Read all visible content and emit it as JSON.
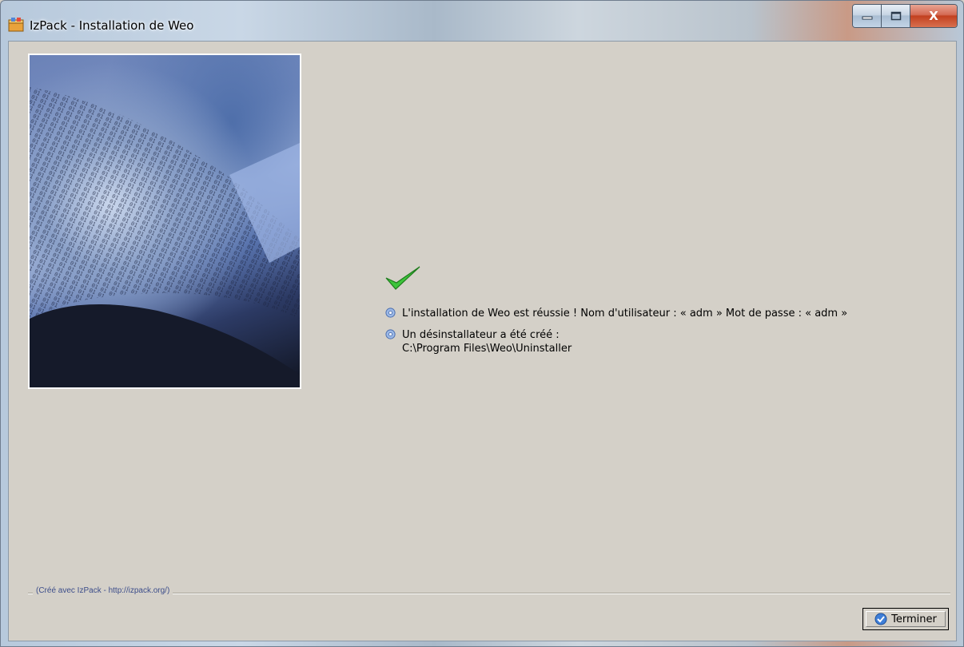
{
  "window": {
    "title": "IzPack - Installation de Weo",
    "controls": {
      "minimize": "–",
      "maximize": "□",
      "close": "X"
    }
  },
  "side_panel": {
    "image": "binary-data-sheet-image"
  },
  "finish_panel": {
    "status_icon": "green-checkmark-icon",
    "messages": [
      {
        "icon": "gear-icon",
        "text": "L'installation de Weo est réussie ! Nom d'utilisateur : « adm »  Mot de passe : « adm »"
      },
      {
        "icon": "gear-icon",
        "text": "Un désinstallateur a été créé :"
      }
    ],
    "uninstaller_path": "C:\\Program Files\\Weo\\Uninstaller"
  },
  "footer": {
    "credit": "(Créé avec IzPack - http://izpack.org/)",
    "finish_button_label": "Terminer"
  },
  "colors": {
    "panel_background": "#d4d0c8",
    "credit_text": "#3c4d8a",
    "checkmark": "#3cc43a"
  }
}
